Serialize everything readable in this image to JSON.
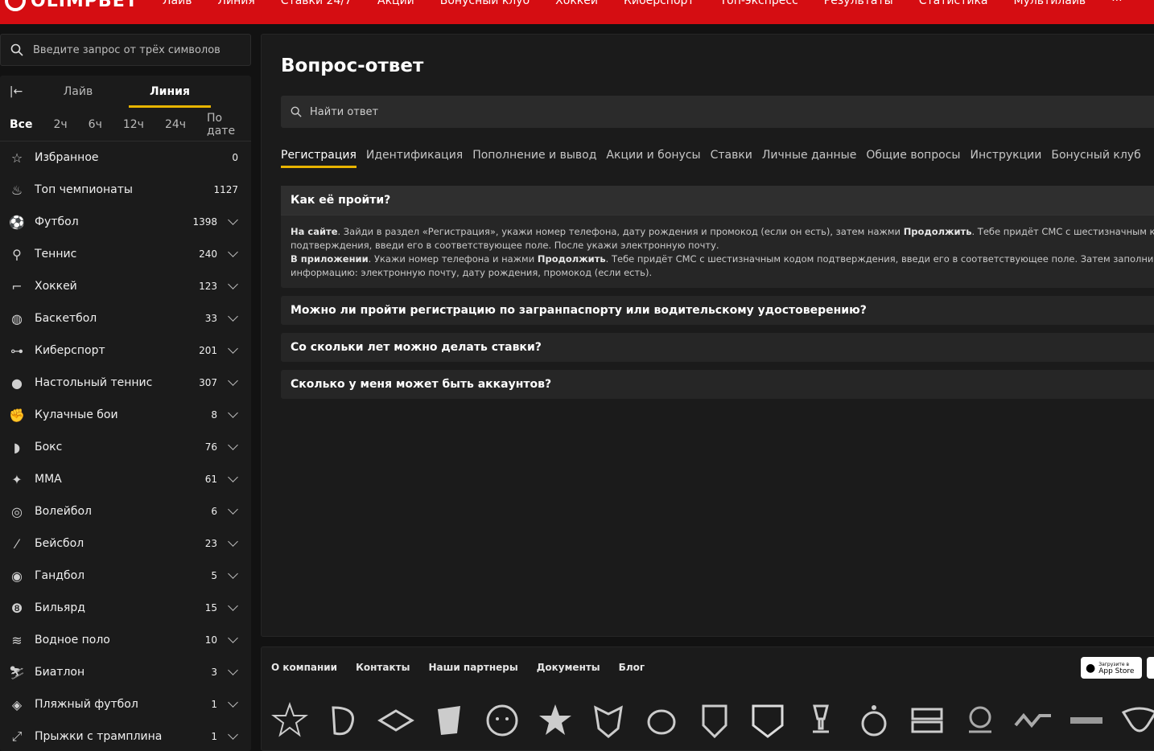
{
  "header": {
    "logo": "OLIMPBET",
    "nav": [
      "Лайв",
      "Линия",
      "Ставки 24/7",
      "Акции",
      "Бонусный клуб",
      "Хоккей",
      "Киберспорт",
      "Топ-экспресс",
      "Результаты",
      "Статистика",
      "Мультилайв",
      "···"
    ]
  },
  "sidebar": {
    "search_placeholder": "Введите запрос от трёх символов",
    "mode_tabs": [
      "Лайв",
      "Линия"
    ],
    "time_filters": [
      "Все",
      "2ч",
      "6ч",
      "12ч",
      "24ч",
      "По дате"
    ],
    "sports": [
      {
        "name": "Избранное",
        "count": "0",
        "icon": "star-icon",
        "chevron": false
      },
      {
        "name": "Топ чемпионаты",
        "count": "1127",
        "icon": "fire-icon",
        "chevron": false
      },
      {
        "name": "Футбол",
        "count": "1398",
        "icon": "football-icon",
        "chevron": true
      },
      {
        "name": "Теннис",
        "count": "240",
        "icon": "tennis-icon",
        "chevron": true
      },
      {
        "name": "Хоккей",
        "count": "123",
        "icon": "hockey-icon",
        "chevron": true
      },
      {
        "name": "Баскетбол",
        "count": "33",
        "icon": "basketball-icon",
        "chevron": true
      },
      {
        "name": "Киберспорт",
        "count": "201",
        "icon": "gamepad-icon",
        "chevron": true
      },
      {
        "name": "Настольный теннис",
        "count": "307",
        "icon": "table-tennis-icon",
        "chevron": true
      },
      {
        "name": "Кулачные бои",
        "count": "8",
        "icon": "fist-icon",
        "chevron": true
      },
      {
        "name": "Бокс",
        "count": "76",
        "icon": "boxing-glove-icon",
        "chevron": true
      },
      {
        "name": "MMA",
        "count": "61",
        "icon": "mma-icon",
        "chevron": true
      },
      {
        "name": "Волейбол",
        "count": "6",
        "icon": "volleyball-icon",
        "chevron": true
      },
      {
        "name": "Бейсбол",
        "count": "23",
        "icon": "baseball-bat-icon",
        "chevron": true
      },
      {
        "name": "Гандбол",
        "count": "5",
        "icon": "handball-icon",
        "chevron": true
      },
      {
        "name": "Бильярд",
        "count": "15",
        "icon": "billiard-ball-icon",
        "chevron": true
      },
      {
        "name": "Водное поло",
        "count": "10",
        "icon": "water-polo-icon",
        "chevron": true
      },
      {
        "name": "Биатлон",
        "count": "3",
        "icon": "biathlon-icon",
        "chevron": true
      },
      {
        "name": "Пляжный футбол",
        "count": "1",
        "icon": "beach-football-icon",
        "chevron": true
      },
      {
        "name": "Прыжки с трамплина",
        "count": "1",
        "icon": "ski-jump-icon",
        "chevron": true
      }
    ]
  },
  "faq": {
    "title": "Вопрос-ответ",
    "search_placeholder": "Найти ответ",
    "categories": [
      "Регистрация",
      "Идентификация",
      "Пополнение и вывод",
      "Акции и бонусы",
      "Ставки",
      "Личные данные",
      "Общие вопросы",
      "Инструкции",
      "Бонусный клуб"
    ],
    "open_item": {
      "question": "Как её пройти?",
      "site_label": "На сайте",
      "site_text_1": ". Зайди в раздел «Регистрация», укажи номер телефона, дату рождения и промокод (если он есть), затем нажми ",
      "site_button": "Продолжить",
      "site_text_2": ". Тебе придёт СМС с шестизначным кодом",
      "site_text_3": "подтверждения, введи его в соответствующее поле. После укажи электронную почту.",
      "app_label": "В приложении",
      "app_text_1": ". Укажи номер телефона и нажми ",
      "app_button": "Продолжить",
      "app_text_2": ". Тебе придёт СМС с шестизначным кодом подтверждения, введи его в соответствующее поле. Затем заполни добавь оставшуюся",
      "app_text_3": "информацию: электронную почту, дату рождения, промокод (если есть)."
    },
    "questions": [
      "Можно ли пройти регистрацию по загранпаспорту или водительскому удостоверению?",
      "Со скольки лет можно делать ставки?",
      "Сколько у меня может быть аккаунтов?"
    ]
  },
  "footer": {
    "links": [
      "О компании",
      "Контакты",
      "Наши партнеры",
      "Документы",
      "Блог"
    ],
    "appstore_small": "Загрузите в",
    "appstore_big": "App Store"
  },
  "colors": {
    "brand_red": "#d50d12",
    "accent_yellow": "#e8b400",
    "panel_bg": "#1b1b1b",
    "page_bg": "#121212"
  }
}
